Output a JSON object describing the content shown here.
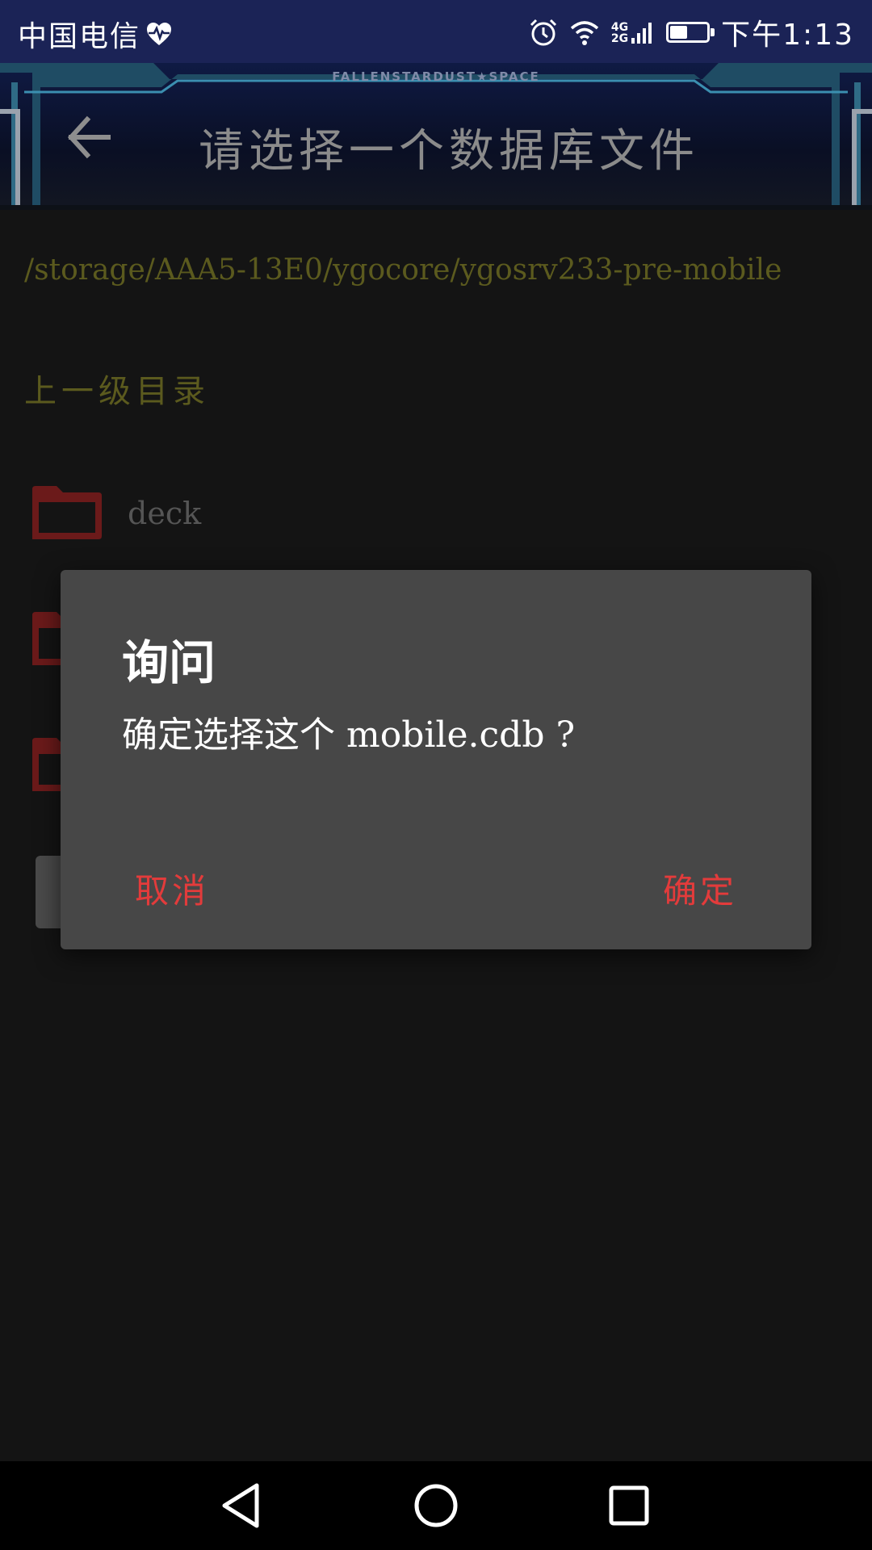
{
  "status_bar": {
    "carrier": "中国电信",
    "carrier_icon": "heart-pulse-icon",
    "net_top": "4G",
    "net_bottom": "2G",
    "time": "下午1:13",
    "icons": [
      "alarm-icon",
      "wifi-icon",
      "signal-icon",
      "battery-icon"
    ],
    "battery_level": 0.44
  },
  "header": {
    "brand": "FALLENSTARDUST★SPACE",
    "title": "请选择一个数据库文件",
    "back_icon": "arrow-left-icon"
  },
  "browser": {
    "path": "/storage/AAA5-13E0/ygocore/ygosrv233-pre-mobile",
    "parent_label": "上一级目录",
    "items": [
      {
        "name": "deck",
        "icon": "folder-icon"
      },
      {
        "name": "",
        "icon": "folder-icon"
      },
      {
        "name": "",
        "icon": "folder-icon"
      }
    ]
  },
  "dialog": {
    "title": "询问",
    "message": "确定选择这个 mobile.cdb ?",
    "cancel_label": "取消",
    "confirm_label": "确定"
  },
  "nav_bar": {
    "icons": [
      "nav-back-icon",
      "nav-home-icon",
      "nav-recent-icon"
    ]
  },
  "colors": {
    "status_bar": "#1b2356",
    "background": "#141414",
    "path_text": "#5b5a1e",
    "folder": "#6b1a1a",
    "dialog_bg": "#474747",
    "dialog_button": "#e33b3b"
  }
}
